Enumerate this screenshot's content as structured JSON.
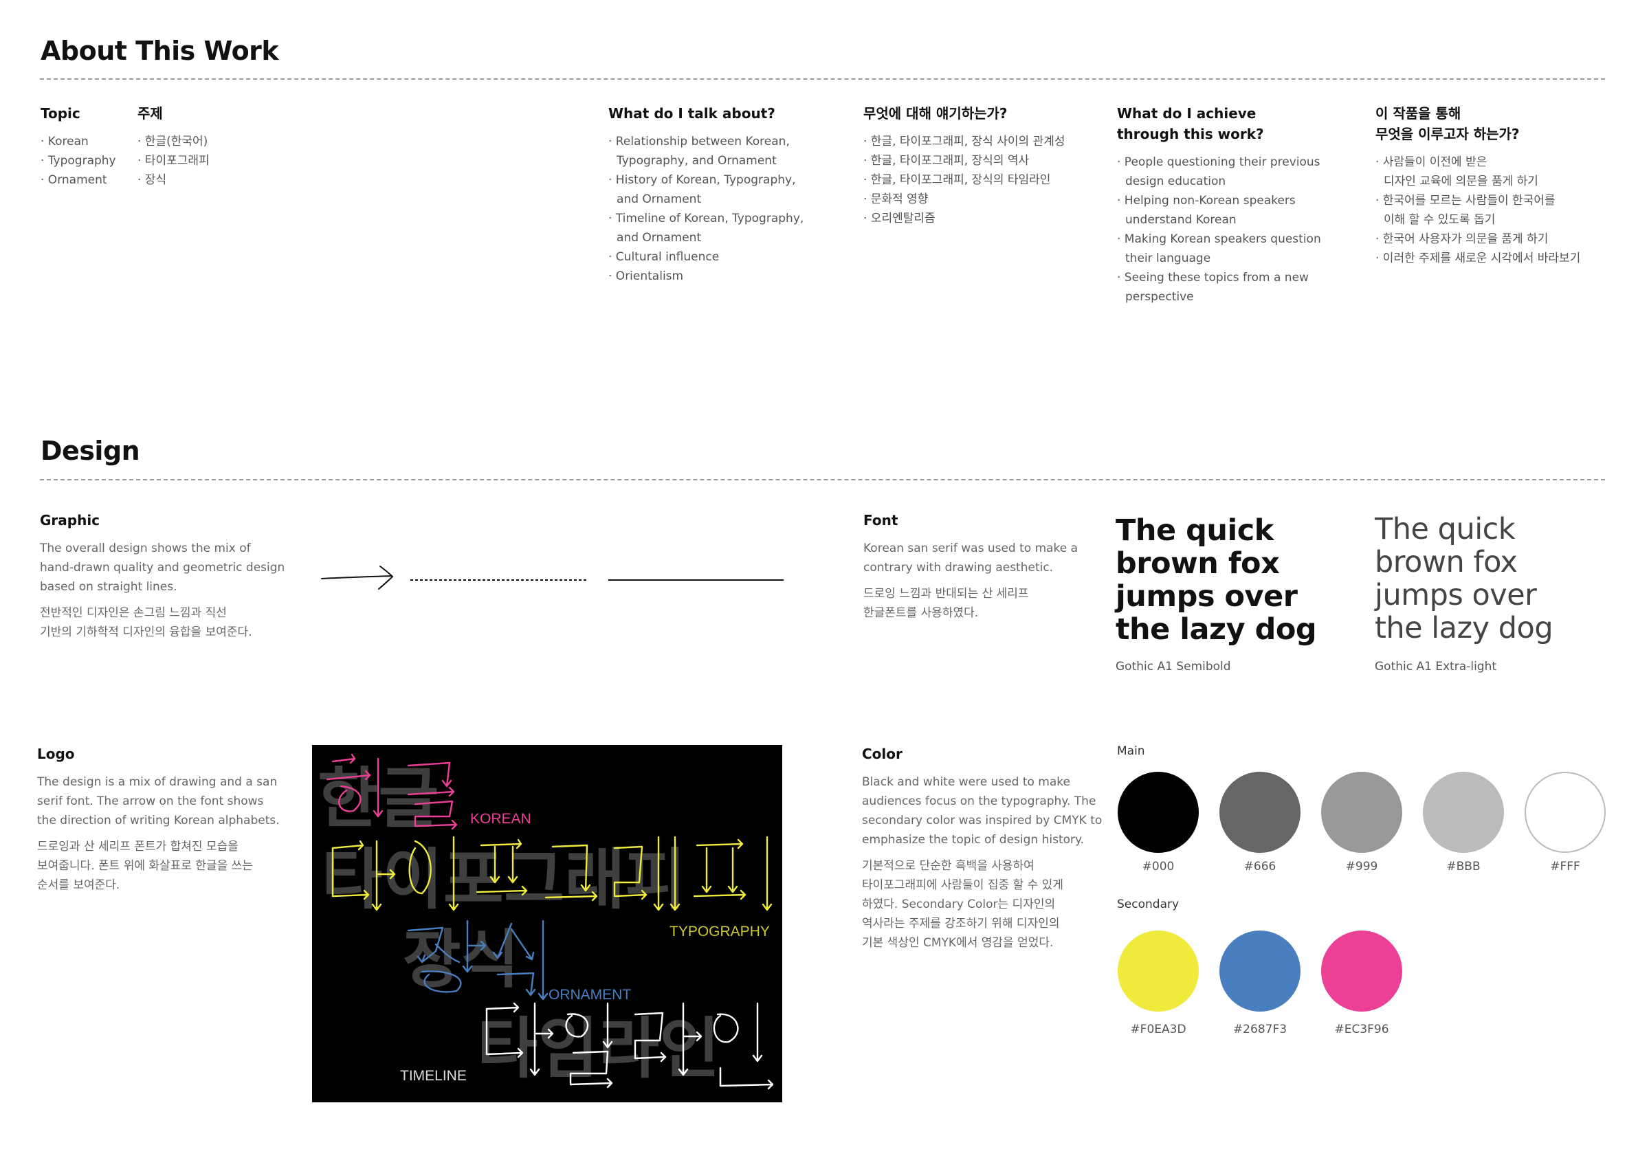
{
  "about": {
    "title": "About This Work",
    "topic": {
      "heading": "Topic",
      "items": [
        "· Korean",
        "· Typography",
        "· Ornament"
      ]
    },
    "topic_ko": {
      "heading": "주제",
      "items": [
        "· 한글(한국어)",
        "· 타이포그래피",
        "· 장식"
      ]
    },
    "talk": {
      "heading": "What do I talk about?",
      "items": [
        "· Relationship between Korean,\nTypography, and Ornament",
        "· History of Korean, Typography,\nand Ornament",
        "· Timeline of Korean, Typography,\nand Ornament",
        "· Cultural influence",
        "· Orientalism"
      ]
    },
    "talk_ko": {
      "heading": "무엇에 대해 얘기하는가?",
      "items": [
        "· 한글, 타이포그래피, 장식 사이의 관계성",
        "· 한글, 타이포그래피, 장식의 역사",
        "· 한글, 타이포그래피, 장식의 타임라인",
        "· 문화적 영향",
        "· 오리엔탈리즘"
      ]
    },
    "achieve": {
      "heading_1": "What do I achieve",
      "heading_2": "through this work?",
      "items": [
        "· People questioning their previous\ndesign education",
        "· Helping non-Korean speakers\nunderstand Korean",
        "· Making Korean speakers question\ntheir language",
        "· Seeing these topics from a new\nperspective"
      ]
    },
    "achieve_ko": {
      "heading_1": "이 작품을 통해",
      "heading_2": "무엇을 이루고자 하는가?",
      "items": [
        "· 사람들이 이전에 받은\n디자인 교육에 의문을 품게 하기",
        "· 한국어를 모르는 사람들이 한국어를\n이해 할 수 있도록 돕기",
        "· 한국어 사용자가 의문을 품게 하기",
        "· 이러한 주제를 새로운 시각에서 바라보기"
      ]
    }
  },
  "design": {
    "title": "Design",
    "graphic": {
      "heading": "Graphic",
      "en_1": "The overall design shows the mix of",
      "en_2": "hand-drawn quality and geometric design",
      "en_3": "based on straight lines.",
      "ko_1": "전반적인 디자인은 손그림 느낌과 직선",
      "ko_2": "기반의 기하학적 디자인의 융합을 보여준다."
    },
    "font": {
      "heading": "Font",
      "en_1": "Korean san serif was used to make a",
      "en_2": "contrary with drawing aesthetic.",
      "ko_1": "드로잉 느낌과 반대되는 산 세리프",
      "ko_2": "한글폰트를 사용하였다.",
      "sample_lines": [
        "The quick",
        "brown fox",
        "jumps over",
        "the lazy dog"
      ],
      "semibold_caption": "Gothic A1 Semibold",
      "extralight_caption": "Gothic A1 Extra-light"
    },
    "logo": {
      "heading": "Logo",
      "en_1": "The design is a mix of drawing and a san",
      "en_2": "serif font. The arrow on the font shows",
      "en_3": "the direction of writing Korean alphabets.",
      "ko_1": "드로잉과 산 세리프 폰트가 합쳐진 모습을",
      "ko_2": "보여줍니다. 폰트 위에 화살표로 한글을 쓰는",
      "ko_3": "순서를 보여준다.",
      "words": {
        "hangul": "한글",
        "typography": "타이포그래피",
        "ornament": "장식",
        "timeline": "타임라인"
      },
      "tags": {
        "korean": "KOREAN",
        "typography": "TYPOGRAPHY",
        "ornament": "ORNAMENT",
        "timeline": "TIMELINE"
      }
    },
    "color": {
      "heading": "Color",
      "en_1": "Black and white were used to make",
      "en_2": "audiences focus on the typography. The",
      "en_3": "secondary color was inspired by CMYK to",
      "en_4": "emphasize the topic of design history.",
      "ko_1": "기본적으로 단순한 흑백을 사용하여",
      "ko_2": "타이포그래피에 사람들이 집중 할 수 있게",
      "ko_3": "하였다. Secondary Color는 디자인의",
      "ko_4": "역사라는 주제를 강조하기 위해 디자인의",
      "ko_5": "기본 색상인 CMYK에서 영감을 얻었다.",
      "main_label": "Main",
      "secondary_label": "Secondary",
      "main": [
        {
          "label": "#000",
          "hex": "#000000"
        },
        {
          "label": "#666",
          "hex": "#666666"
        },
        {
          "label": "#999",
          "hex": "#999999"
        },
        {
          "label": "#BBB",
          "hex": "#BBBBBB"
        },
        {
          "label": "#FFF",
          "hex": "#FFFFFF"
        }
      ],
      "secondary": [
        {
          "label": "#F0EA3D",
          "hex": "#F0EA3D"
        },
        {
          "label": "#2687F3",
          "hex": "#4A7FBF"
        },
        {
          "label": "#EC3F96",
          "hex": "#EC3F96"
        }
      ]
    }
  }
}
